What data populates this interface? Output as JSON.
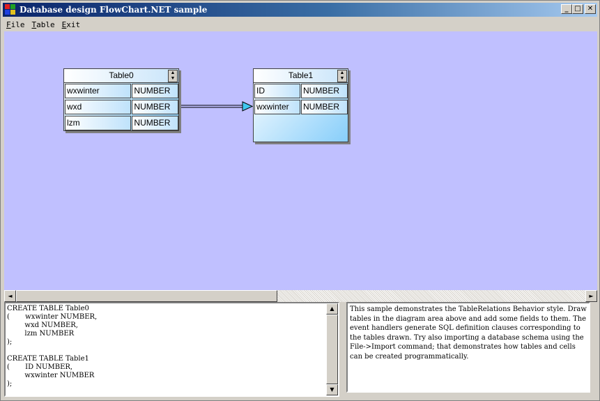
{
  "window": {
    "title": "Database design FlowChart.NET sample",
    "minimize": "_",
    "maximize": "□",
    "close": "✕"
  },
  "menu": {
    "file": {
      "accel": "F",
      "rest": "ile"
    },
    "table": {
      "accel": "T",
      "rest": "able"
    },
    "exit": {
      "accel": "E",
      "rest": "xit"
    }
  },
  "diagram": {
    "background": "#c0c0ff",
    "tables": [
      {
        "name": "Table0",
        "rows": [
          {
            "field": "wxwinter",
            "type": "NUMBER"
          },
          {
            "field": "wxd",
            "type": "NUMBER"
          },
          {
            "field": "lzm",
            "type": "NUMBER"
          }
        ]
      },
      {
        "name": "Table1",
        "rows": [
          {
            "field": "ID",
            "type": "NUMBER"
          },
          {
            "field": "wxwinter",
            "type": "NUMBER"
          }
        ]
      }
    ],
    "relation": {
      "from": "Table0.wxd",
      "to": "Table1.wxwinter"
    }
  },
  "scroll_arrows": {
    "left": "◄",
    "right": "►",
    "up": "▲",
    "down": "▼"
  },
  "sql_output": "CREATE TABLE Table0\n(       wxwinter NUMBER,\n        wxd NUMBER,\n        lzm NUMBER\n);\n\nCREATE TABLE Table1\n(       ID NUMBER,\n        wxwinter NUMBER\n);",
  "description": "This sample demonstrates the TableRelations Behavior style. Draw tables in the diagram area above and add some fields to them. The event handlers generate SQL definition clauses corresponding to the tables drawn. Try also importing a database schema using the File->Import command; that demonstrates how tables and cells can be created programmatically."
}
